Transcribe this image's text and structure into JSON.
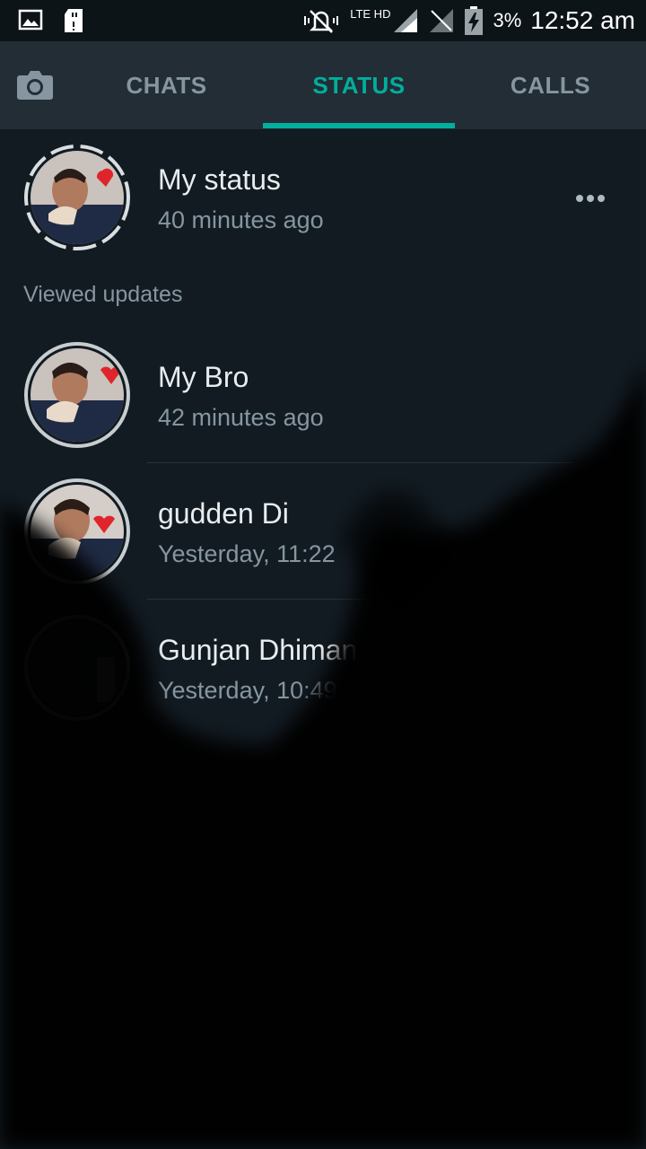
{
  "status_bar": {
    "network": "LTE HD",
    "battery": "3%",
    "time": "12:52 am"
  },
  "tabs": [
    {
      "label": "CHATS"
    },
    {
      "label": "STATUS"
    },
    {
      "label": "CALLS"
    }
  ],
  "my_status": {
    "name": "My status",
    "time": "40 minutes ago"
  },
  "section_label": "Viewed updates",
  "updates": [
    {
      "name": "My Bro",
      "time": "42 minutes ago"
    },
    {
      "name": "gudden Di",
      "time": "Yesterday, 11:22"
    },
    {
      "name": "Gunjan Dhiman",
      "time": "Yesterday, 10:49"
    }
  ],
  "colors": {
    "accent": "#00af9c",
    "appbar": "#232d36",
    "background": "#121b22"
  }
}
